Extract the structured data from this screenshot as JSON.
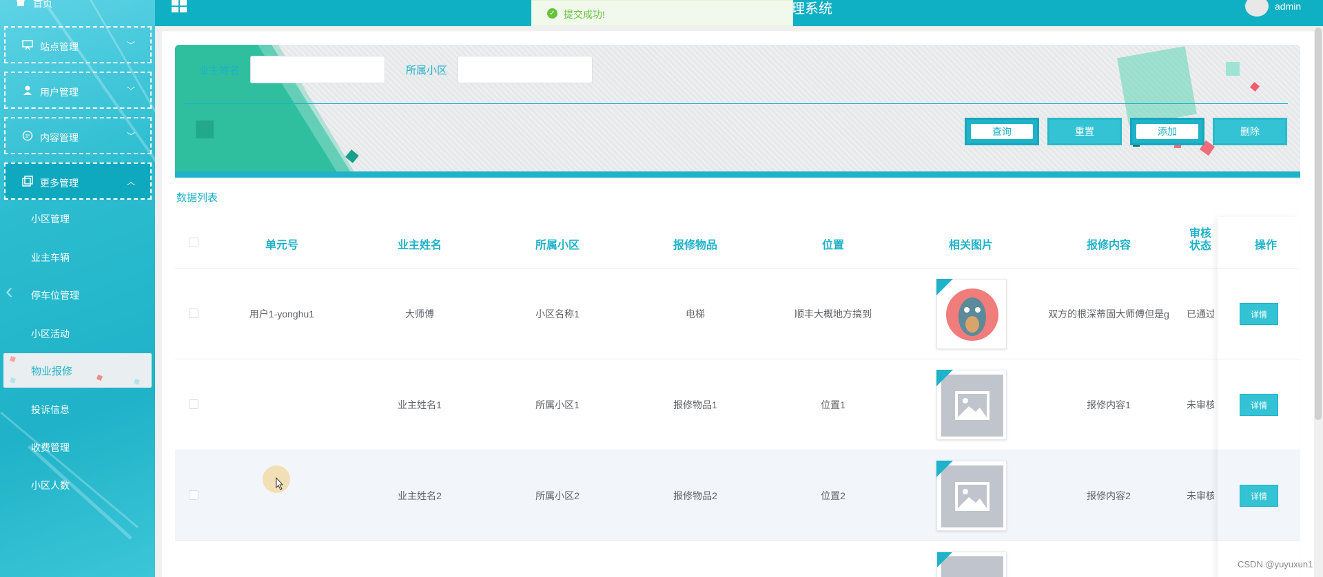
{
  "sidebar": {
    "home_label": "首页",
    "groups": [
      {
        "label": "站点管理",
        "icon": "monitor-icon",
        "chevron": "﹀"
      },
      {
        "label": "用户管理",
        "icon": "user-icon",
        "chevron": "﹀"
      },
      {
        "label": "内容管理",
        "icon": "chat-icon",
        "chevron": "﹀"
      },
      {
        "label": "更多管理",
        "icon": "copy-icon",
        "chevron": "︿"
      }
    ],
    "items": [
      "小区管理",
      "业主车辆",
      "停车位管理",
      "小区活动",
      "物业报修",
      "投诉信息",
      "收费管理",
      "小区人数"
    ],
    "active_item": "物业报修"
  },
  "topbar": {
    "title": "理系统",
    "user": "admin"
  },
  "toast": {
    "message": "提交成功!"
  },
  "search": {
    "owner_label": "业主姓名",
    "community_label": "所属小区",
    "owner_value": "",
    "community_value": ""
  },
  "buttons": {
    "query": "查询",
    "reset": "重置",
    "add": "添加",
    "delete": "删除"
  },
  "list_title": "数据列表",
  "table": {
    "headers": [
      "单元号",
      "业主姓名",
      "所属小区",
      "报修物品",
      "位置",
      "相关图片",
      "报修内容",
      "审核状态",
      "操作"
    ],
    "rows": [
      {
        "unit": "用户1-yonghu1",
        "owner": "大师傅",
        "community": "小区名称1",
        "item": "电梯",
        "location": "顺丰大概地方搞到",
        "image": "avatar-image",
        "content": "双方的根深蒂固大师傅但是g",
        "status": "已通过",
        "action": "详情"
      },
      {
        "unit": "",
        "owner": "业主姓名1",
        "community": "所属小区1",
        "item": "报修物品1",
        "location": "位置1",
        "image": "placeholder-image",
        "content": "报修内容1",
        "status": "未审核",
        "action": "详情"
      },
      {
        "unit": "",
        "owner": "业主姓名2",
        "community": "所属小区2",
        "item": "报修物品2",
        "location": "位置2",
        "image": "placeholder-image",
        "content": "报修内容2",
        "status": "未审核",
        "action": "详情"
      }
    ]
  },
  "watermark": "CSDN @yuyuxun1",
  "colors": {
    "accent": "#1fb2c8",
    "topbar": "#0fb0c4",
    "success": "#67c23a"
  }
}
